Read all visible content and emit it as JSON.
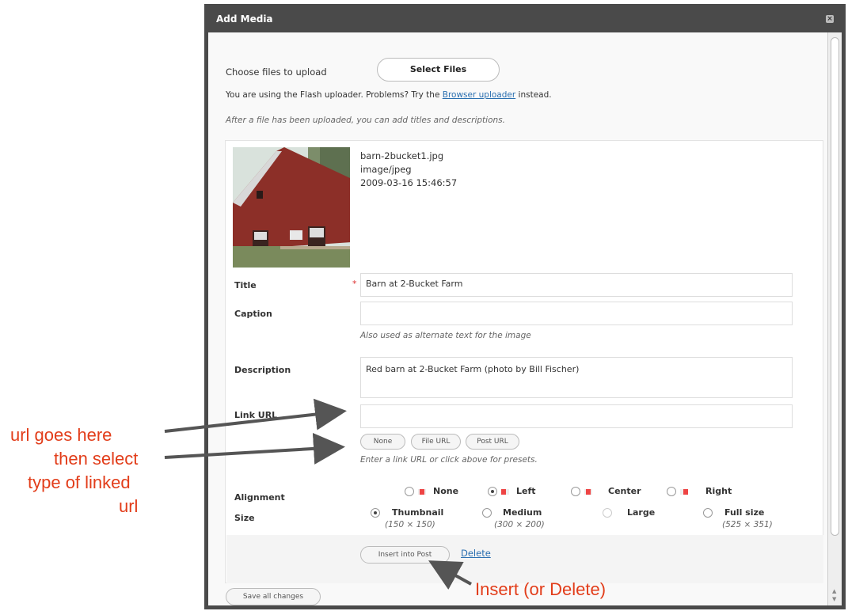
{
  "dialog": {
    "title": "Add Media",
    "close_icon": "close-icon"
  },
  "upload": {
    "choose_label": "Choose files to upload",
    "select_files_button": "Select Files",
    "flash_notice_pre": "You are using the Flash uploader. Problems? Try the",
    "browser_uploader_link": "Browser uploader",
    "flash_notice_post": "instead.",
    "after_note": "After a file has been uploaded, you can add titles and descriptions."
  },
  "file": {
    "name": "barn-2bucket1.jpg",
    "mime": "image/jpeg",
    "date": "2009-03-16 15:46:57"
  },
  "fields": {
    "title_label": "Title",
    "title_required_mark": "*",
    "title_value": "Barn at 2-Bucket Farm",
    "caption_label": "Caption",
    "caption_value": "",
    "caption_help": "Also used as alternate text for the image",
    "description_label": "Description",
    "description_value": "Red barn at 2-Bucket Farm (photo by Bill Fischer)",
    "link_url_label": "Link URL",
    "link_url_value": "",
    "link_buttons": [
      "None",
      "File URL",
      "Post URL"
    ],
    "link_help": "Enter a link URL or click above for presets.",
    "alignment_label": "Alignment",
    "alignment_options": [
      "None",
      "Left",
      "Center",
      "Right"
    ],
    "alignment_selected": "Left",
    "size_label": "Size",
    "size_options": [
      {
        "label": "Thumbnail",
        "dims": "(150 × 150)"
      },
      {
        "label": "Medium",
        "dims": "(300 × 200)"
      },
      {
        "label": "Large",
        "dims": ""
      },
      {
        "label": "Full size",
        "dims": "(525 × 351)"
      }
    ],
    "size_selected": "Thumbnail"
  },
  "actions": {
    "insert_button": "Insert into Post",
    "delete_link": "Delete",
    "save_all_button": "Save all changes"
  },
  "annotations": {
    "url_note_1": "url goes here",
    "url_note_2": "then select",
    "url_note_3": "type of linked",
    "url_note_4": "url",
    "insert_note": "Insert (or Delete)"
  },
  "colors": {
    "annotation": "#e23d1a",
    "link": "#2a6fb0",
    "dialog_frame": "#4a4a4a"
  }
}
